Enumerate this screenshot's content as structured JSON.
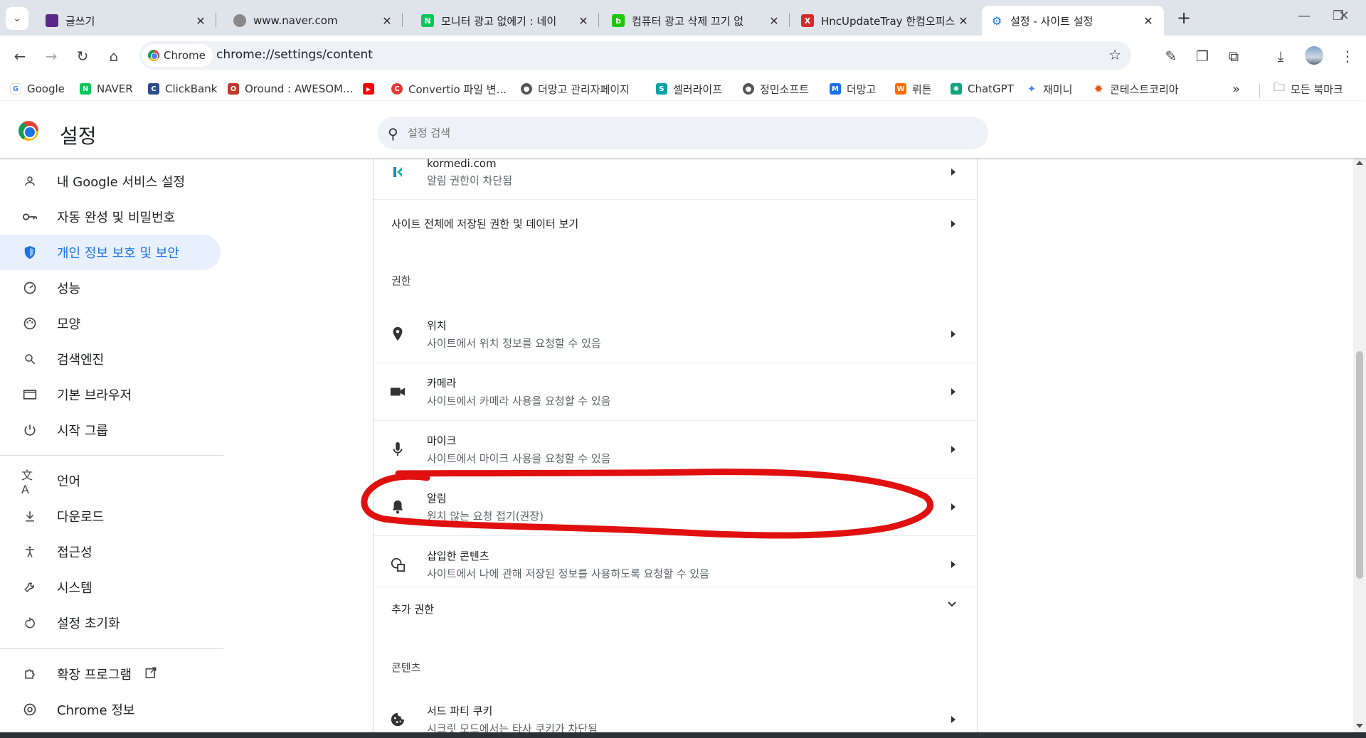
{
  "tabs": [
    {
      "title": "글쓰기",
      "fav_color": "#5b2a86",
      "fav_glyph": ""
    },
    {
      "title": "www.naver.com",
      "fav_color": "#777777",
      "fav_glyph": ""
    },
    {
      "title": "모니터 광고 없에기 : 네이",
      "fav_color": "#03c75a",
      "fav_glyph": "N"
    },
    {
      "title": "컴퓨터 광고 삭제 끄기 없",
      "fav_color": "#1ec800",
      "fav_glyph": "b"
    },
    {
      "title": "HncUpdateTray 한컴오피스",
      "fav_color": "#d62b2b",
      "fav_glyph": "X"
    },
    {
      "title": "설정 - 사이트 설정",
      "fav_color": "#1a73e8",
      "fav_glyph": "⚙"
    }
  ],
  "omnibox": {
    "chip_label": "Chrome",
    "url": "chrome://settings/content"
  },
  "bookmarks": [
    {
      "label": "Google",
      "color": "#4285f4",
      "glyph": "G"
    },
    {
      "label": "NAVER",
      "color": "#03c75a",
      "glyph": "N"
    },
    {
      "label": "ClickBank",
      "color": "#2a4b8d",
      "glyph": "C"
    },
    {
      "label": "Oround : AWESOM...",
      "color": "#c0392b",
      "glyph": "O"
    },
    {
      "label": "",
      "color": "#ff0000",
      "glyph": "▶"
    },
    {
      "label": "Convertio 파일 변...",
      "color": "#e53935",
      "glyph": "C"
    },
    {
      "label": "더망고 관리자페이지",
      "color": "#555555",
      "glyph": "●"
    },
    {
      "label": "셀러라이프",
      "color": "#00a3a3",
      "glyph": "S"
    },
    {
      "label": "정민소프트",
      "color": "#555555",
      "glyph": "●"
    },
    {
      "label": "더망고",
      "color": "#1a73e8",
      "glyph": "M"
    },
    {
      "label": "뤼튼",
      "color": "#ff6d00",
      "glyph": "W"
    },
    {
      "label": "ChatGPT",
      "color": "#10a37f",
      "glyph": "✺"
    },
    {
      "label": "재미니",
      "color": "#4f7ff0",
      "glyph": "✦"
    },
    {
      "label": "콘테스트코리아",
      "color": "#e8561c",
      "glyph": "✹"
    }
  ],
  "all_bookmarks_label": "모든 북마크",
  "settings": {
    "title": "설정",
    "search_placeholder": "설정 검색"
  },
  "sidebar": [
    {
      "label": "내 Google 서비스 설정",
      "icon": "person-icon"
    },
    {
      "label": "자동 완성 및 비밀번호",
      "icon": "key-icon"
    },
    {
      "label": "개인 정보 보호 및 보안",
      "icon": "shield-icon",
      "active": true
    },
    {
      "label": "성능",
      "icon": "speedometer-icon"
    },
    {
      "label": "모양",
      "icon": "palette-icon"
    },
    {
      "label": "검색엔진",
      "icon": "search-icon"
    },
    {
      "label": "기본 브라우저",
      "icon": "browser-icon"
    },
    {
      "label": "시작 그룹",
      "icon": "power-icon"
    },
    {
      "label": "언어",
      "icon": "translate-icon"
    },
    {
      "label": "다운로드",
      "icon": "download-icon"
    },
    {
      "label": "접근성",
      "icon": "accessibility-icon"
    },
    {
      "label": "시스템",
      "icon": "wrench-icon"
    },
    {
      "label": "설정 초기화",
      "icon": "reset-icon"
    },
    {
      "label": "확장 프로그램",
      "icon": "extension-icon"
    },
    {
      "label": "Chrome 정보",
      "icon": "chrome-icon"
    }
  ],
  "content": {
    "recent_site": {
      "title": "kormedi.com",
      "subtitle": "알림 권한이 차단됨"
    },
    "view_all_label": "사이트 전체에 저장된 권한 및 데이터 보기",
    "permissions_heading": "권한",
    "permissions": [
      {
        "title": "위치",
        "subtitle": "사이트에서 위치 정보를 요청할 수 있음",
        "icon": "location-pin-icon"
      },
      {
        "title": "카메라",
        "subtitle": "사이트에서 카메라 사용을 요청할 수 있음",
        "icon": "camera-icon"
      },
      {
        "title": "마이크",
        "subtitle": "사이트에서 마이크 사용을 요청할 수 있음",
        "icon": "microphone-icon"
      },
      {
        "title": "알림",
        "subtitle": "원치 않는 요청 접기(권장)",
        "icon": "bell-icon"
      },
      {
        "title": "삽입한 콘텐츠",
        "subtitle": "사이트에서 나에 관해 저장된 정보를 사용하도록 요청할 수 있음",
        "icon": "embedded-content-icon"
      }
    ],
    "additional_permissions_label": "추가 권한",
    "content_heading": "콘텐츠",
    "cookies": {
      "title": "서드 파티 쿠키",
      "subtitle": "시크릿 모드에서는 타사 쿠키가 차단됨",
      "icon": "cookie-icon"
    }
  },
  "colors": {
    "accent": "#1a73e8",
    "annotation": "#e01010"
  }
}
